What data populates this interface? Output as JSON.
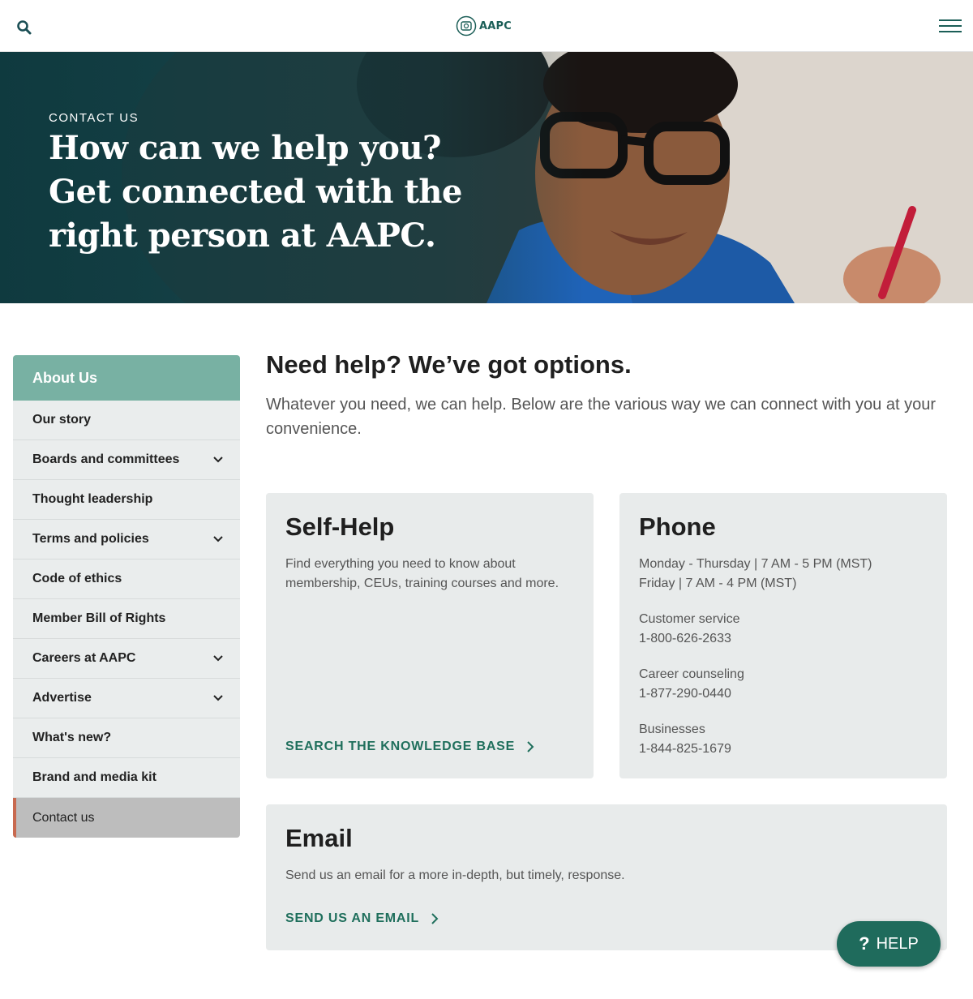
{
  "header": {
    "logo_text": "AAPC",
    "icons": {
      "search": "search-icon",
      "menu": "hamburger-menu-icon",
      "logo": "aapc-logo-icon"
    }
  },
  "hero": {
    "eyebrow": "CONTACT US",
    "title": "How can we help you? Get connected with the right person at AAPC."
  },
  "sidebar": {
    "heading": "About Us",
    "items": [
      {
        "label": "Our story",
        "expandable": false
      },
      {
        "label": "Boards and committees",
        "expandable": true
      },
      {
        "label": "Thought leadership",
        "expandable": false
      },
      {
        "label": "Terms and policies",
        "expandable": true
      },
      {
        "label": "Code of ethics",
        "expandable": false
      },
      {
        "label": "Member Bill of Rights",
        "expandable": false
      },
      {
        "label": "Careers at AAPC",
        "expandable": true
      },
      {
        "label": "Advertise",
        "expandable": true
      },
      {
        "label": "What's new?",
        "expandable": false
      },
      {
        "label": "Brand and media kit",
        "expandable": false
      },
      {
        "label": "Contact us",
        "expandable": false,
        "active": true
      }
    ]
  },
  "main": {
    "title": "Need help? We’ve got options.",
    "subtitle": "Whatever you need, we can help. Below are the various way we can connect with you at your convenience."
  },
  "cards": {
    "self_help": {
      "title": "Self-Help",
      "text": "Find everything you need to know about membership, CEUs, training courses and more.",
      "link": "SEARCH THE KNOWLEDGE BASE"
    },
    "phone": {
      "title": "Phone",
      "hours_1": "Monday - Thursday | 7 AM - 5 PM (MST)",
      "hours_2": "Friday | 7 AM - 4 PM (MST)",
      "contacts": [
        {
          "label": "Customer service",
          "number": "1-800-626-2633"
        },
        {
          "label": "Career counseling",
          "number": "1-877-290-0440"
        },
        {
          "label": "Businesses",
          "number": "1-844-825-1679"
        }
      ]
    },
    "email": {
      "title": "Email",
      "text": "Send us an email for a more in-depth, but timely, response.",
      "link": "SEND US AN EMAIL"
    }
  },
  "help_button": {
    "label": "HELP",
    "icon": "question-mark-icon"
  },
  "colors": {
    "brand_green": "#1f6b5c",
    "sidebar_header": "#78b1a3",
    "active_accent": "#c8694f",
    "card_bg": "#e8ebeb"
  }
}
